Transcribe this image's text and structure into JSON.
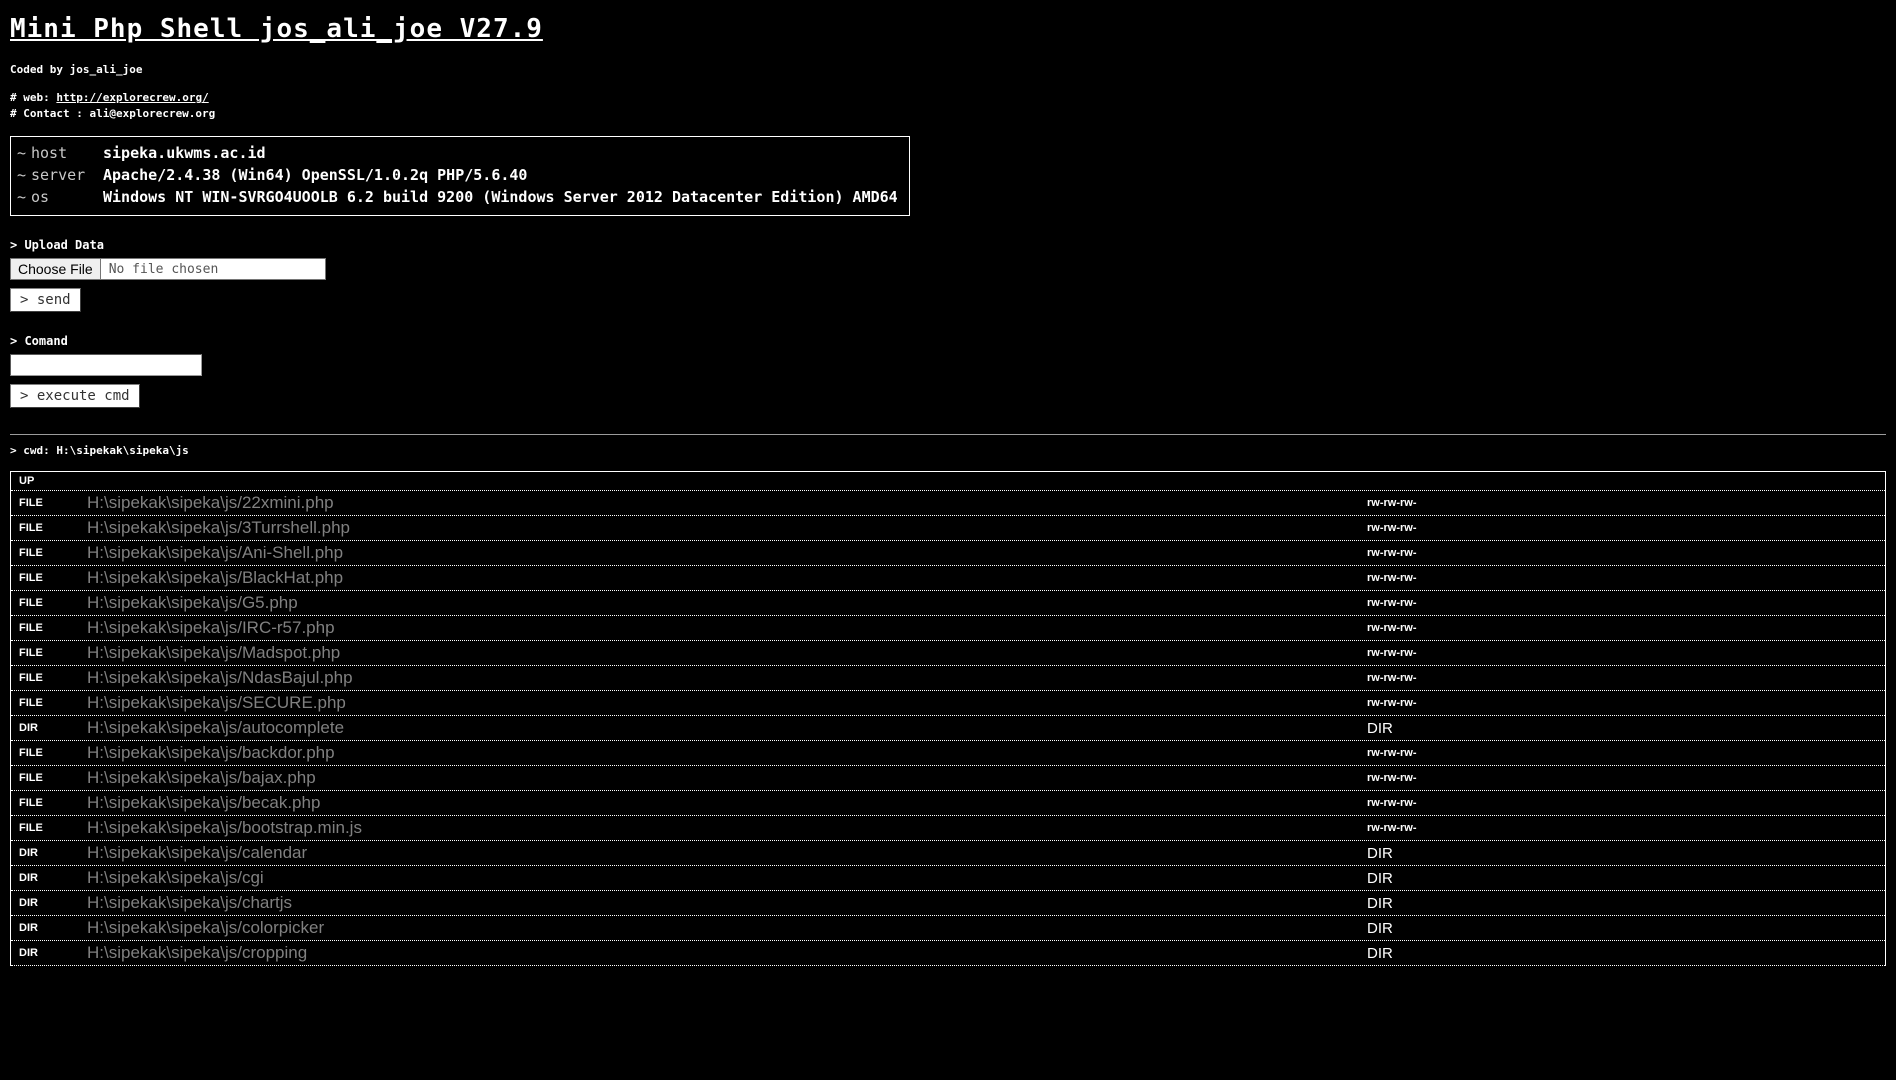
{
  "header": {
    "title": "Mini Php Shell jos_ali_joe V27.9",
    "coded_by": "Coded by jos_ali_joe",
    "web_label": "# web:",
    "web_url": "http://explorecrew.org/",
    "contact_line": "# Contact : ali@explorecrew.org"
  },
  "info": {
    "tilde": "~",
    "host_key": "host",
    "host_value": "sipeka.ukwms.ac.id",
    "server_key": "server",
    "server_value": "Apache/2.4.38 (Win64) OpenSSL/1.0.2q PHP/5.6.40",
    "os_key": "os",
    "os_value": "Windows NT WIN-SVRGO4UOOLB 6.2 build 9200 (Windows Server 2012 Datacenter Edition) AMD64"
  },
  "upload": {
    "label": "> Upload Data",
    "choose_file_label": "Choose File",
    "file_value": "No file chosen",
    "send_label": "> send"
  },
  "command": {
    "label": "> Comand",
    "input_value": "",
    "execute_label": "> execute cmd"
  },
  "cwd": {
    "text": "> cwd: H:\\sipekak\\sipeka\\js"
  },
  "listing": {
    "up_label": "UP",
    "rows": [
      {
        "type": "FILE",
        "name": "H:\\sipekak\\sipeka\\js/22xmini.php",
        "perm": "rw-rw-rw-"
      },
      {
        "type": "FILE",
        "name": "H:\\sipekak\\sipeka\\js/3Turrshell.php",
        "perm": "rw-rw-rw-"
      },
      {
        "type": "FILE",
        "name": "H:\\sipekak\\sipeka\\js/Ani-Shell.php",
        "perm": "rw-rw-rw-"
      },
      {
        "type": "FILE",
        "name": "H:\\sipekak\\sipeka\\js/BlackHat.php",
        "perm": "rw-rw-rw-"
      },
      {
        "type": "FILE",
        "name": "H:\\sipekak\\sipeka\\js/G5.php",
        "perm": "rw-rw-rw-"
      },
      {
        "type": "FILE",
        "name": "H:\\sipekak\\sipeka\\js/IRC-r57.php",
        "perm": "rw-rw-rw-"
      },
      {
        "type": "FILE",
        "name": "H:\\sipekak\\sipeka\\js/Madspot.php",
        "perm": "rw-rw-rw-"
      },
      {
        "type": "FILE",
        "name": "H:\\sipekak\\sipeka\\js/NdasBajul.php",
        "perm": "rw-rw-rw-"
      },
      {
        "type": "FILE",
        "name": "H:\\sipekak\\sipeka\\js/SECURE.php",
        "perm": "rw-rw-rw-"
      },
      {
        "type": "DIR",
        "name": "H:\\sipekak\\sipeka\\js/autocomplete",
        "perm": "DIR"
      },
      {
        "type": "FILE",
        "name": "H:\\sipekak\\sipeka\\js/backdor.php",
        "perm": "rw-rw-rw-"
      },
      {
        "type": "FILE",
        "name": "H:\\sipekak\\sipeka\\js/bajax.php",
        "perm": "rw-rw-rw-"
      },
      {
        "type": "FILE",
        "name": "H:\\sipekak\\sipeka\\js/becak.php",
        "perm": "rw-rw-rw-"
      },
      {
        "type": "FILE",
        "name": "H:\\sipekak\\sipeka\\js/bootstrap.min.js",
        "perm": "rw-rw-rw-"
      },
      {
        "type": "DIR",
        "name": "H:\\sipekak\\sipeka\\js/calendar",
        "perm": "DIR"
      },
      {
        "type": "DIR",
        "name": "H:\\sipekak\\sipeka\\js/cgi",
        "perm": "DIR"
      },
      {
        "type": "DIR",
        "name": "H:\\sipekak\\sipeka\\js/chartjs",
        "perm": "DIR"
      },
      {
        "type": "DIR",
        "name": "H:\\sipekak\\sipeka\\js/colorpicker",
        "perm": "DIR"
      },
      {
        "type": "DIR",
        "name": "H:\\sipekak\\sipeka\\js/cropping",
        "perm": "DIR"
      }
    ]
  },
  "colors": {
    "background": "#000000",
    "text": "#ffffff",
    "link_gray": "#808080",
    "key_gray": "#c8c8c8"
  }
}
